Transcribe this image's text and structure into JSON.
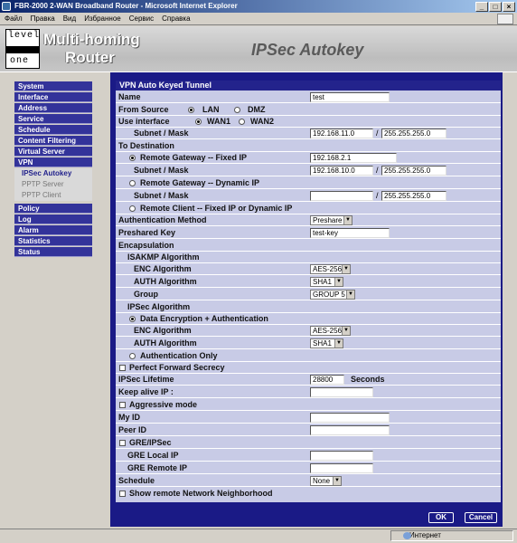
{
  "window": {
    "title": "FBR-2000 2-WAN Broadband Router - Microsoft Internet Explorer",
    "min": "_",
    "max": "□",
    "close": "×"
  },
  "menu": [
    "Файл",
    "Правка",
    "Вид",
    "Избранное",
    "Сервис",
    "Справка"
  ],
  "header": {
    "logo_top": "level",
    "logo_bottom": "one",
    "brand_line1": "Multi-homing",
    "brand_line2": "Router",
    "page_title": "IPSec Autokey"
  },
  "nav": {
    "items": [
      {
        "label": "System",
        "type": "head"
      },
      {
        "label": "Interface",
        "type": "head"
      },
      {
        "label": "Address",
        "type": "head"
      },
      {
        "label": "Service",
        "type": "head"
      },
      {
        "label": "Schedule",
        "type": "head"
      },
      {
        "label": "Content Filtering",
        "type": "head"
      },
      {
        "label": "Virtual Server",
        "type": "head"
      },
      {
        "label": "VPN",
        "type": "head"
      },
      {
        "label": "IPSec Autokey",
        "type": "sub-active"
      },
      {
        "label": "PPTP Server",
        "type": "sub"
      },
      {
        "label": "PPTP Client",
        "type": "sub"
      },
      {
        "label": "Policy",
        "type": "head"
      },
      {
        "label": "Log",
        "type": "head"
      },
      {
        "label": "Alarm",
        "type": "head"
      },
      {
        "label": "Statistics",
        "type": "head"
      },
      {
        "label": "Status",
        "type": "head"
      }
    ]
  },
  "form": {
    "header": "VPN Auto Keyed Tunnel",
    "name_label": "Name",
    "name_value": "test",
    "from_source_label": "From Source",
    "lan": "LAN",
    "dmz": "DMZ",
    "use_interface_label": "Use interface",
    "wan1": "WAN1",
    "wan2": "WAN2",
    "subnet_mask_label": "Subnet / Mask",
    "src_subnet": "192.168.11.0",
    "src_mask": "255.255.255.0",
    "slash": "/",
    "to_destination_label": "To Destination",
    "remote_fixed_label": "Remote Gateway -- Fixed IP",
    "remote_fixed_ip": "192.168.2.1",
    "fixed_subnet": "192.168.10.0",
    "fixed_mask": "255.255.255.0",
    "remote_dynamic_label": "Remote Gateway -- Dynamic IP",
    "dynamic_subnet": "",
    "dynamic_mask": "255.255.255.0",
    "remote_client_label": "Remote Client -- Fixed IP or Dynamic IP",
    "auth_method_label": "Authentication Method",
    "auth_method_value": "Preshare",
    "preshared_key_label": "Preshared Key",
    "preshared_key_value": "test-key",
    "encapsulation_label": "Encapsulation",
    "isakmp_label": "ISAKMP Algorithm",
    "enc_algorithm_label": "ENC Algorithm",
    "isakmp_enc_value": "AES-256",
    "auth_algorithm_label": "AUTH Algorithm",
    "isakmp_auth_value": "SHA1",
    "group_label": "Group",
    "group_value": "GROUP 5",
    "ipsec_label": "IPSec Algorithm",
    "data_enc_auth_label": "Data Encryption + Authentication",
    "ipsec_enc_value": "AES-256",
    "ipsec_auth_value": "SHA1",
    "auth_only_label": "Authentication Only",
    "pfs_label": "Perfect Forward Secrecy",
    "ipsec_lifetime_label": "IPSec Lifetime",
    "ipsec_lifetime_value": "28800",
    "seconds": "Seconds",
    "keepalive_label": "Keep alive IP :",
    "keepalive_value": "",
    "aggressive_label": "Aggressive mode",
    "my_id_label": "My ID",
    "my_id_value": "",
    "peer_id_label": "Peer ID",
    "peer_id_value": "",
    "gre_label": "GRE/IPSec",
    "gre_local_label": "GRE Local IP",
    "gre_local_value": "",
    "gre_remote_label": "GRE Remote IP",
    "gre_remote_value": "",
    "schedule_label": "Schedule",
    "schedule_value": "None",
    "show_remote_label": "Show remote Network Neighborhood",
    "ok_label": "OK",
    "cancel_label": "Cancel",
    "arrow": "▼"
  },
  "status": {
    "zone_label": "Интернет"
  }
}
